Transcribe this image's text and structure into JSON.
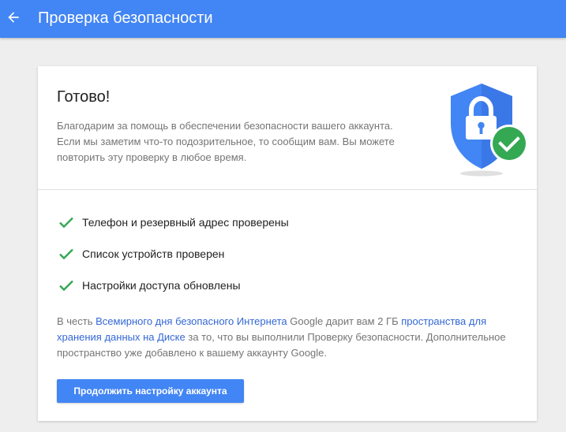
{
  "header": {
    "title": "Проверка безопасности",
    "back_icon": "arrow-back-icon",
    "background_color": "#4285f4"
  },
  "result": {
    "title": "Готово!",
    "description": "Благодарим за помощь в обеспечении безопасности вашего аккаунта. Если мы заметим что-то подозрительное, то сообщим вам. Вы можете повторить эту проверку в любое время.",
    "illustration_icon": "shield-lock-check-icon"
  },
  "checks": [
    {
      "label": "Телефон и резервный адрес проверены",
      "icon": "check-icon"
    },
    {
      "label": "Список устройств проверен",
      "icon": "check-icon"
    },
    {
      "label": "Настройки доступа обновлены",
      "icon": "check-icon"
    }
  ],
  "bonus": {
    "text_1": "В честь ",
    "link_1": "Всемирного дня безопасного Интернета",
    "text_2": " Google дарит вам 2 ГБ ",
    "link_2": "пространства для хранения данных на Диске",
    "text_3": " за то, что вы выполнили Проверку безопасности. Дополнительное пространство уже добавлено к вашему аккаунту Google."
  },
  "continue_button": {
    "label": "Продолжить настройку аккаунта"
  },
  "colors": {
    "accent": "#4285f4",
    "success": "#34a853",
    "link": "#3367d6"
  }
}
